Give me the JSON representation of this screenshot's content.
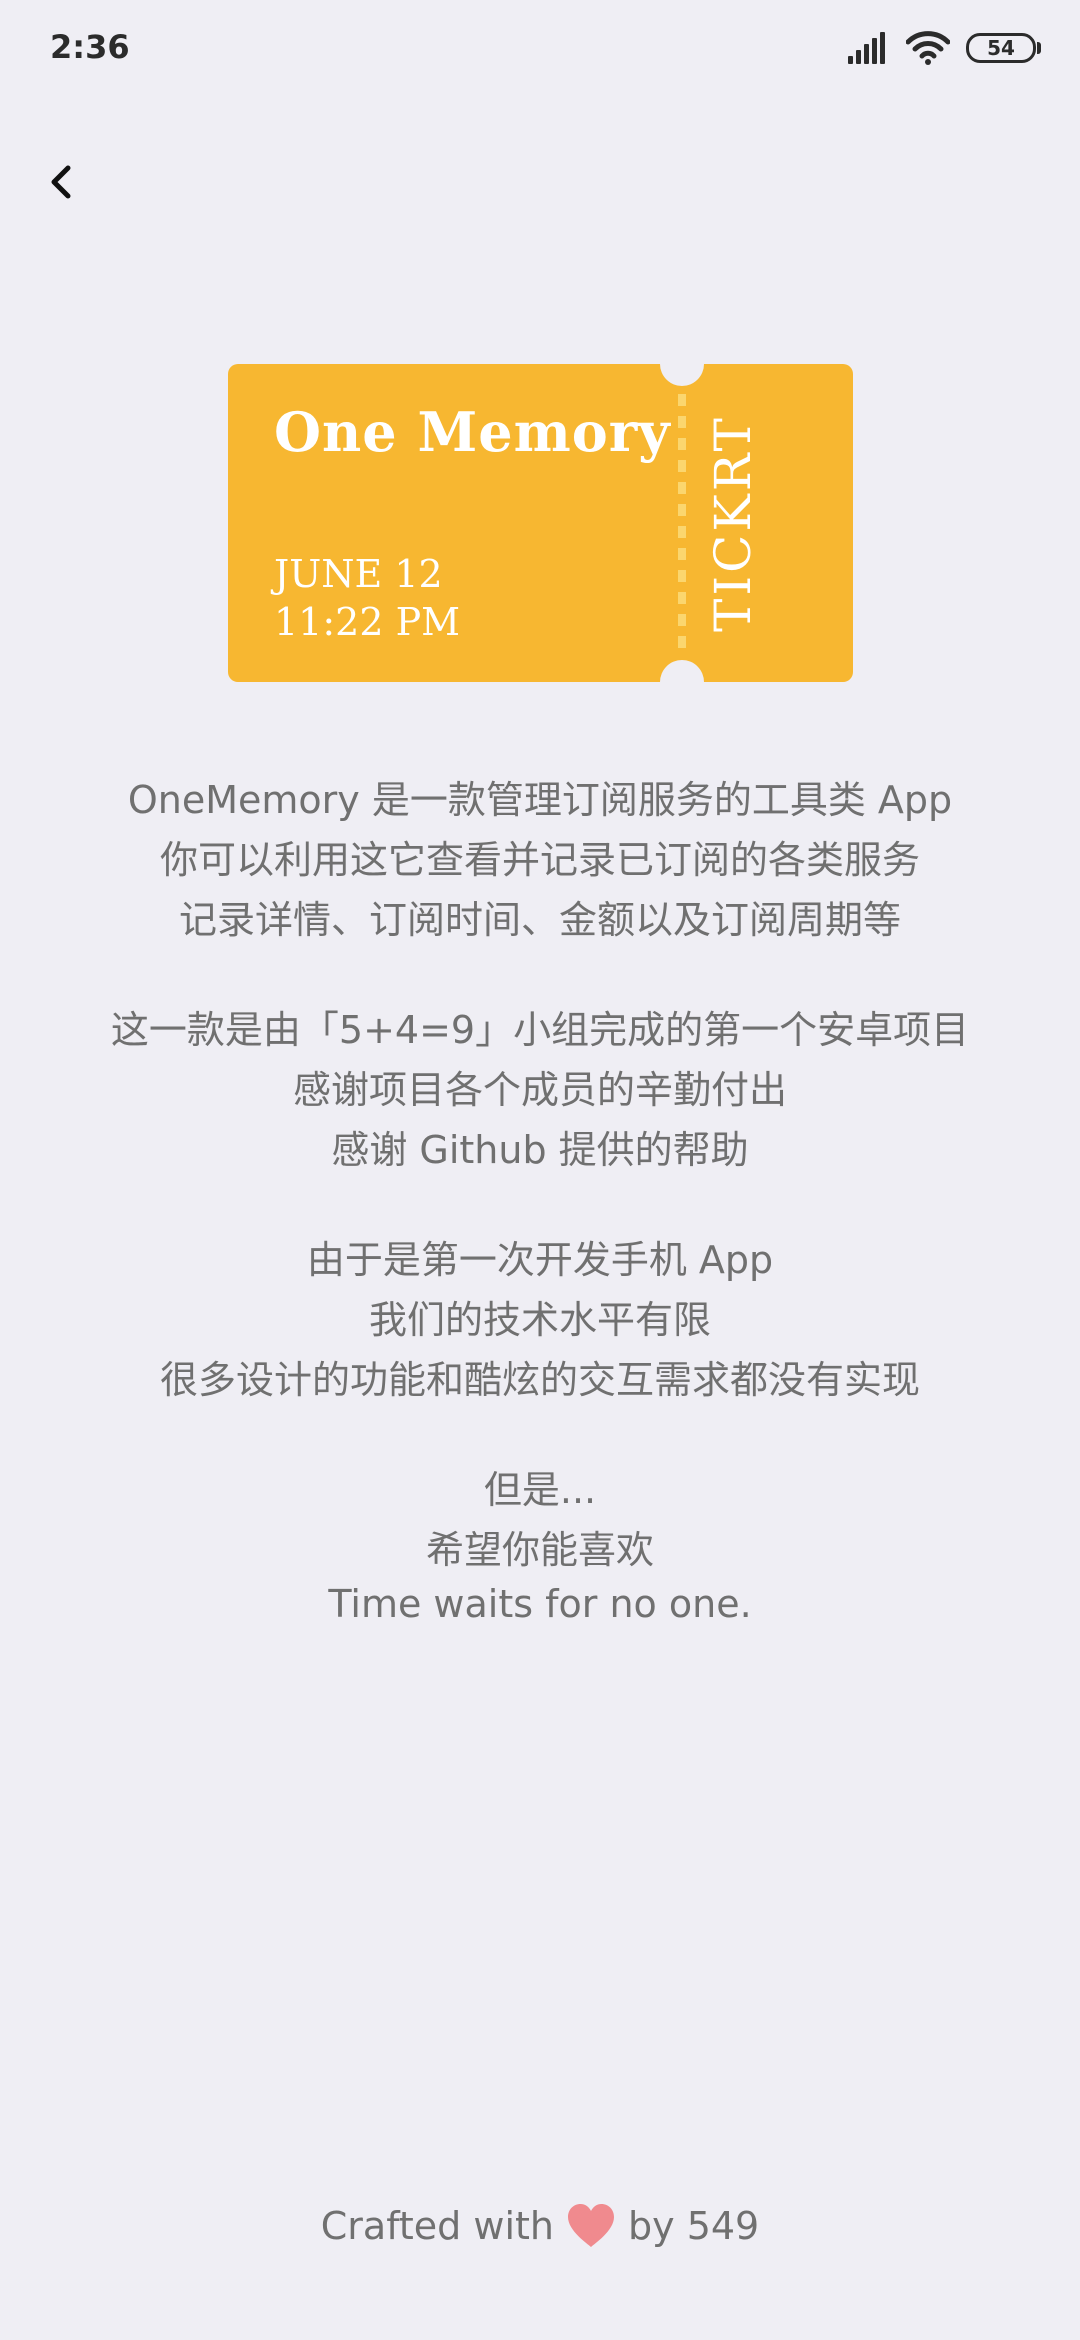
{
  "status_bar": {
    "time": "2:36",
    "battery_level": "54",
    "icons": [
      "signal-icon",
      "wifi-icon",
      "battery-icon"
    ]
  },
  "nav": {
    "back_icon": "chevron-left-icon"
  },
  "ticket": {
    "title": "One Memory",
    "date_line": "JUNE 12",
    "time_line": "11:22 PM",
    "stub_label": "TICKRT",
    "color": "#f7b731"
  },
  "about": {
    "paragraphs": [
      [
        "OneMemory 是一款管理订阅服务的工具类 App",
        "你可以利用这它查看并记录已订阅的各类服务",
        "记录详情、订阅时间、金额以及订阅周期等"
      ],
      [
        "这一款是由「5+4=9」小组完成的第一个安卓项目",
        "感谢项目各个成员的辛勤付出",
        "感谢 Github 提供的帮助"
      ],
      [
        "由于是第一次开发手机 App",
        "我们的技术水平有限",
        "很多设计的功能和酷炫的交互需求都没有实现"
      ],
      [
        "但是...",
        "希望你能喜欢",
        "Time waits for no one."
      ]
    ]
  },
  "footer": {
    "prefix": "Crafted with",
    "icon": "heart-icon",
    "suffix": "by 549",
    "heart_color": "#f08a8e"
  },
  "colors": {
    "background": "#efeef4",
    "text": "#707070"
  }
}
